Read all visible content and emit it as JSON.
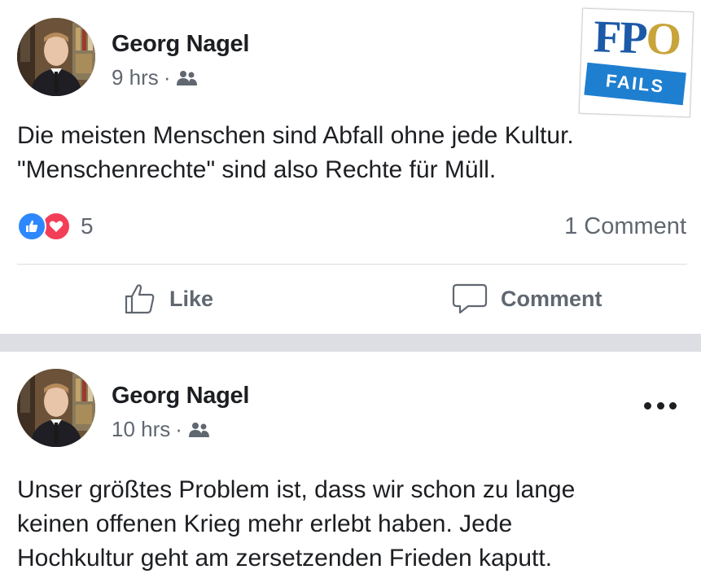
{
  "logo": {
    "fpo_text": "FP",
    "fpo_o": "O",
    "fails_text": "FAILS"
  },
  "posts": [
    {
      "author": "Georg Nagel",
      "time": "9 hrs",
      "separator": "·",
      "audience_icon": "friends-icon",
      "text_lines": [
        "Die meisten Menschen sind Abfall ohne jede Kultur.",
        "\"Menschenrechte\" sind also Rechte für Müll."
      ],
      "reaction_count": "5",
      "comment_count": "1 Comment",
      "actions": {
        "like_label": "Like",
        "comment_label": "Comment"
      }
    },
    {
      "author": "Georg Nagel",
      "time": "10 hrs",
      "separator": "·",
      "audience_icon": "friends-icon",
      "text_lines": [
        "Unser größtes Problem ist, dass wir schon zu lange",
        "keinen offenen Krieg mehr erlebt haben. Jede",
        "Hochkultur geht am zersetzenden Frieden kaputt."
      ]
    }
  ],
  "colors": {
    "like_blue": "#2d88ff",
    "love_red": "#f33e58",
    "meta_gray": "#606770",
    "separator_gray": "#dcdee3"
  }
}
